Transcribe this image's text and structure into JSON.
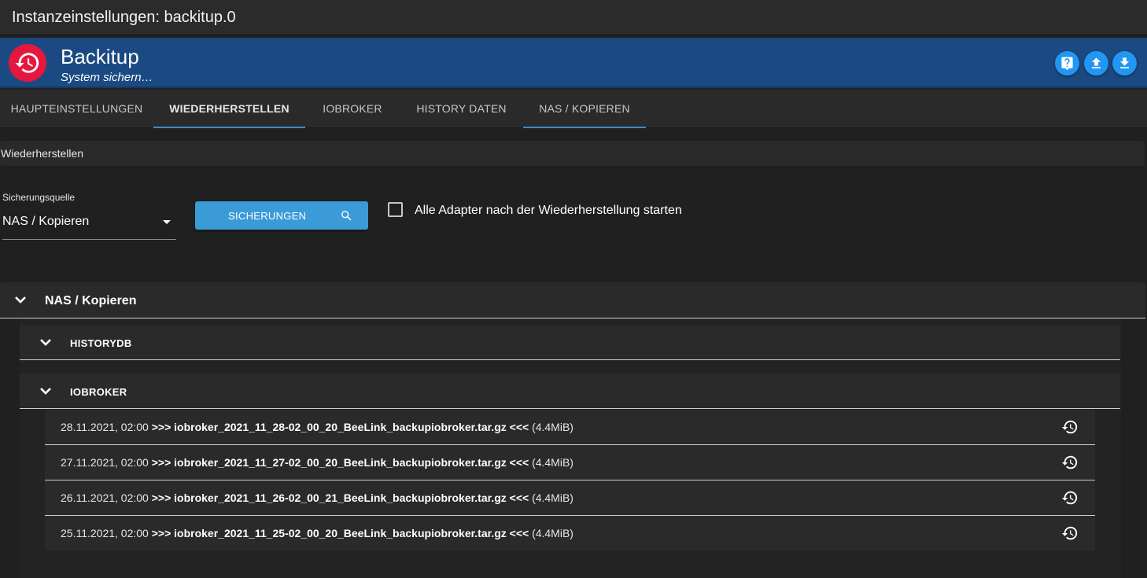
{
  "window": {
    "title": "Instanzeinstellungen: backitup.0"
  },
  "app": {
    "name": "Backitup",
    "subtitle": "System sichern…"
  },
  "header_buttons": [
    {
      "icon": "help-icon"
    },
    {
      "icon": "upload-icon"
    },
    {
      "icon": "download-icon"
    }
  ],
  "tabs": [
    {
      "label": "HAUPTEINSTELLUNGEN",
      "active": false
    },
    {
      "label": "WIEDERHERSTELLEN",
      "active": true
    },
    {
      "label": "IOBROKER",
      "active": false
    },
    {
      "label": "HISTORY DATEN",
      "active": false
    },
    {
      "label": "NAS / KOPIEREN",
      "active": false
    }
  ],
  "restore": {
    "section_title": "Wiederherstellen",
    "source_label": "Sicherungsquelle",
    "source_value": "NAS / Kopieren",
    "search_button": "SICHERUNGEN",
    "start_all_label": "Alle Adapter nach der Wiederherstellung starten",
    "start_all_checked": false
  },
  "tree": {
    "root": "NAS / Kopieren",
    "groups": [
      {
        "name": "HISTORYDB"
      },
      {
        "name": "IOBROKER"
      }
    ],
    "backups": [
      {
        "date": "28.11.2021, 02:00",
        "prefix": ">>>",
        "file": "iobroker_2021_11_28-02_00_20_BeeLink_backupiobroker.tar.gz",
        "suffix": "<<<",
        "size": "(4.4MiB)"
      },
      {
        "date": "27.11.2021, 02:00",
        "prefix": ">>>",
        "file": "iobroker_2021_11_27-02_00_20_BeeLink_backupiobroker.tar.gz",
        "suffix": "<<<",
        "size": "(4.4MiB)"
      },
      {
        "date": "26.11.2021, 02:00",
        "prefix": ">>>",
        "file": "iobroker_2021_11_26-02_00_21_BeeLink_backupiobroker.tar.gz",
        "suffix": "<<<",
        "size": "(4.4MiB)"
      },
      {
        "date": "25.11.2021, 02:00",
        "prefix": ">>>",
        "file": "iobroker_2021_11_25-02_00_20_BeeLink_backupiobroker.tar.gz",
        "suffix": "<<<",
        "size": "(4.4MiB)"
      }
    ]
  },
  "colors": {
    "accent": "#3b9bd6",
    "header": "#1b4a82",
    "logo": "#e5173f",
    "tab_indicator": "#3b8ec9"
  }
}
